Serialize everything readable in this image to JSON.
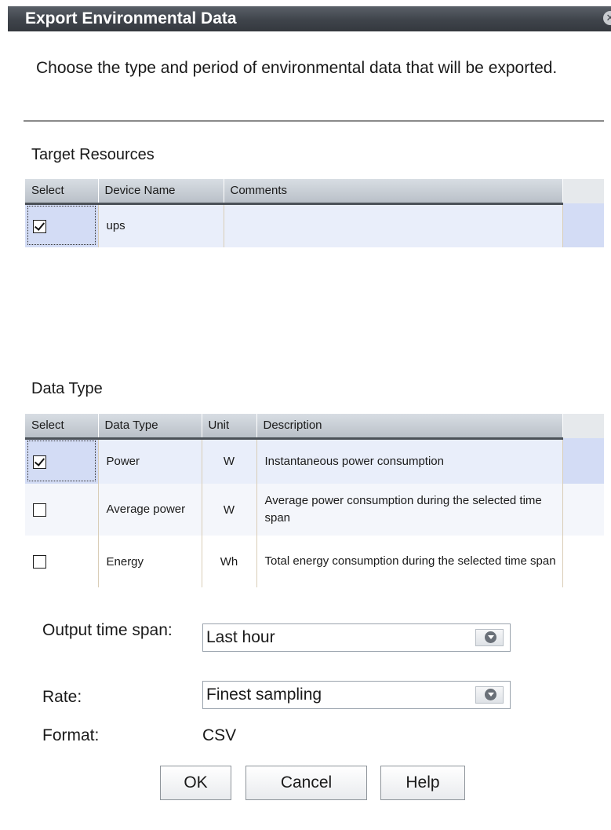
{
  "dialog": {
    "title": "Export Environmental Data",
    "intro": "Choose the type and period of environmental data that will be exported."
  },
  "target_resources": {
    "title": "Target Resources",
    "columns": [
      "Select",
      "Device Name",
      "Comments"
    ],
    "rows": [
      {
        "checked": true,
        "device_name": "ups",
        "comments": ""
      }
    ]
  },
  "data_type": {
    "title": "Data Type",
    "columns": [
      "Select",
      "Data Type",
      "Unit",
      "Description"
    ],
    "rows": [
      {
        "checked": true,
        "type": "Power",
        "unit": "W",
        "description": "Instantaneous power consumption"
      },
      {
        "checked": false,
        "type": "Average power",
        "unit": "W",
        "description": "Average power consumption during the selected time span"
      },
      {
        "checked": false,
        "type": "Energy",
        "unit": "Wh",
        "description": "Total energy consumption during the selected time span"
      }
    ]
  },
  "form": {
    "time_span_label": "Output time span:",
    "time_span_value": "Last hour",
    "rate_label": "Rate:",
    "rate_value": "Finest sampling",
    "format_label": "Format:",
    "format_value": "CSV"
  },
  "buttons": {
    "ok": "OK",
    "cancel": "Cancel",
    "help": "Help"
  }
}
